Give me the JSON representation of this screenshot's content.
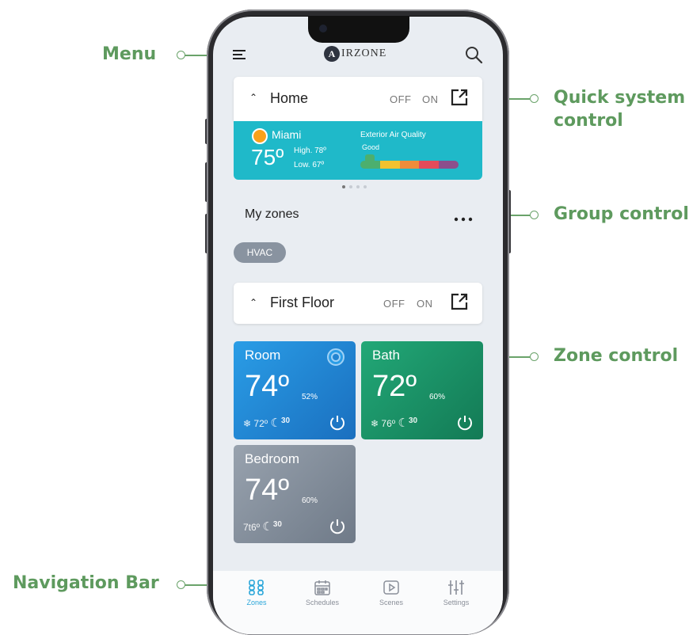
{
  "callouts": {
    "menu": "Menu",
    "quick_system_control_line1": "Quick system",
    "quick_system_control_line2": "control",
    "group_control": "Group control",
    "zone_control": "Zone control",
    "navigation_bar": "Navigation Bar"
  },
  "header": {
    "logo_letter": "A",
    "logo_text": "IRZONE",
    "menu_icon": "hamburger-icon",
    "search_icon": "search-icon"
  },
  "system_card": {
    "title": "Home",
    "off_label": "OFF",
    "on_label": "ON",
    "open_icon": "external-link-icon"
  },
  "weather": {
    "city": "Miami",
    "temperature": "75º",
    "high": "High. 78º",
    "low": "Low. 67º",
    "air_quality_label": "Exterior Air Quality",
    "air_quality_value": "Good",
    "air_quality_colors": [
      "#4caf6e",
      "#f2c230",
      "#ef8c3a",
      "#e44b5a",
      "#8c4f8c"
    ]
  },
  "my_zones": {
    "title": "My zones",
    "more_icon": "more-dots-icon",
    "chip": "HVAC"
  },
  "group_card": {
    "title": "First Floor",
    "off_label": "OFF",
    "on_label": "ON"
  },
  "zones": [
    {
      "name": "Room",
      "temperature": "74º",
      "humidity": "52%",
      "setpoint": "72º",
      "timer": "30",
      "color": "#1f8fdc"
    },
    {
      "name": "Bath",
      "temperature": "72º",
      "humidity": "60%",
      "setpoint": "76º",
      "timer": "30",
      "color": "#1a9a6e"
    },
    {
      "name": "Bedroom",
      "temperature": "74º",
      "humidity": "60%",
      "setpoint": "7t6º",
      "timer": "30",
      "color": "#8a95a3"
    }
  ],
  "nav": {
    "items": [
      {
        "label": "Zones",
        "active": true
      },
      {
        "label": "Schedules",
        "active": false
      },
      {
        "label": "Scenes",
        "active": false
      },
      {
        "label": "Settings",
        "active": false
      }
    ],
    "active_color": "#2aa6d9",
    "inactive_color": "#8a8f99"
  }
}
